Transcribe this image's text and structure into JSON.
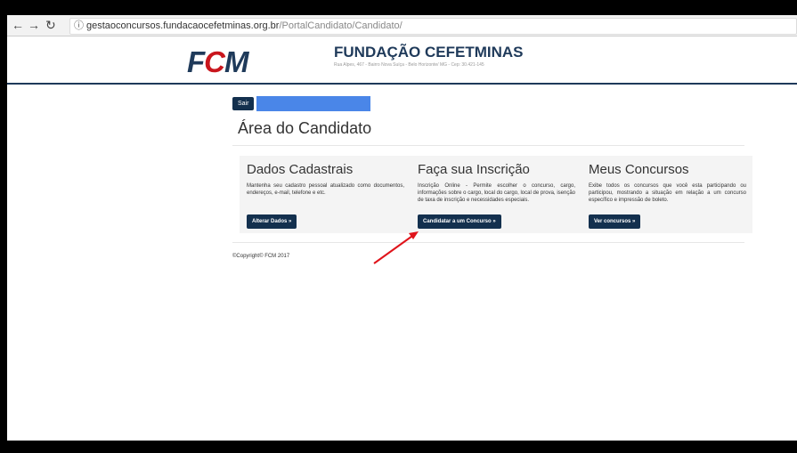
{
  "browser": {
    "url_host": "gestaoconcursos.fundacaocefetminas.org.br",
    "url_path": "/PortalCandidato/Candidato/",
    "back_icon": "arrow-left-icon",
    "forward_icon": "arrow-right-icon",
    "reload_icon": "reload-icon",
    "info_icon": "info-icon"
  },
  "header": {
    "logo_f": "F",
    "logo_c": "C",
    "logo_m": "M",
    "org_name": "FUNDAÇÃO CEFETMINAS",
    "org_address": "Rua Alpes, 467 - Bairro Nova Suíça - Belo Horizonte/ MG - Cep: 30.421-145"
  },
  "user": {
    "sair_label": "Sair"
  },
  "page": {
    "title": "Área do Candidato"
  },
  "cards": [
    {
      "title": "Dados Cadastrais",
      "text": "Mantenha seu cadastro pessoal atualizado como documentos, endereços, e-mail, telefone e etc.",
      "button": "Alterar Dados »"
    },
    {
      "title": "Faça sua Inscrição",
      "text": "Inscrição Online - Permite escolher o concurso, cargo, informações sobre o cargo, local do cargo, local de prova, isenção de taxa de inscrição e necessidades especiais.",
      "button": "Candidatar a um Concurso »"
    },
    {
      "title": "Meus Concursos",
      "text": "Exibe todos os concursos que você esta participando ou participou, mostrando a situação em relação a um concurso específico e impressão de boleto.",
      "button": "Ver concursos »"
    }
  ],
  "footer": {
    "copyright": "©Copyright© FCM 2017"
  },
  "colors": {
    "brand_navy": "#1f3a5a",
    "brand_red": "#c9161d",
    "button_bg": "#13304e",
    "highlight_blue": "#4a86e8",
    "annotation_red": "#e0141b"
  }
}
